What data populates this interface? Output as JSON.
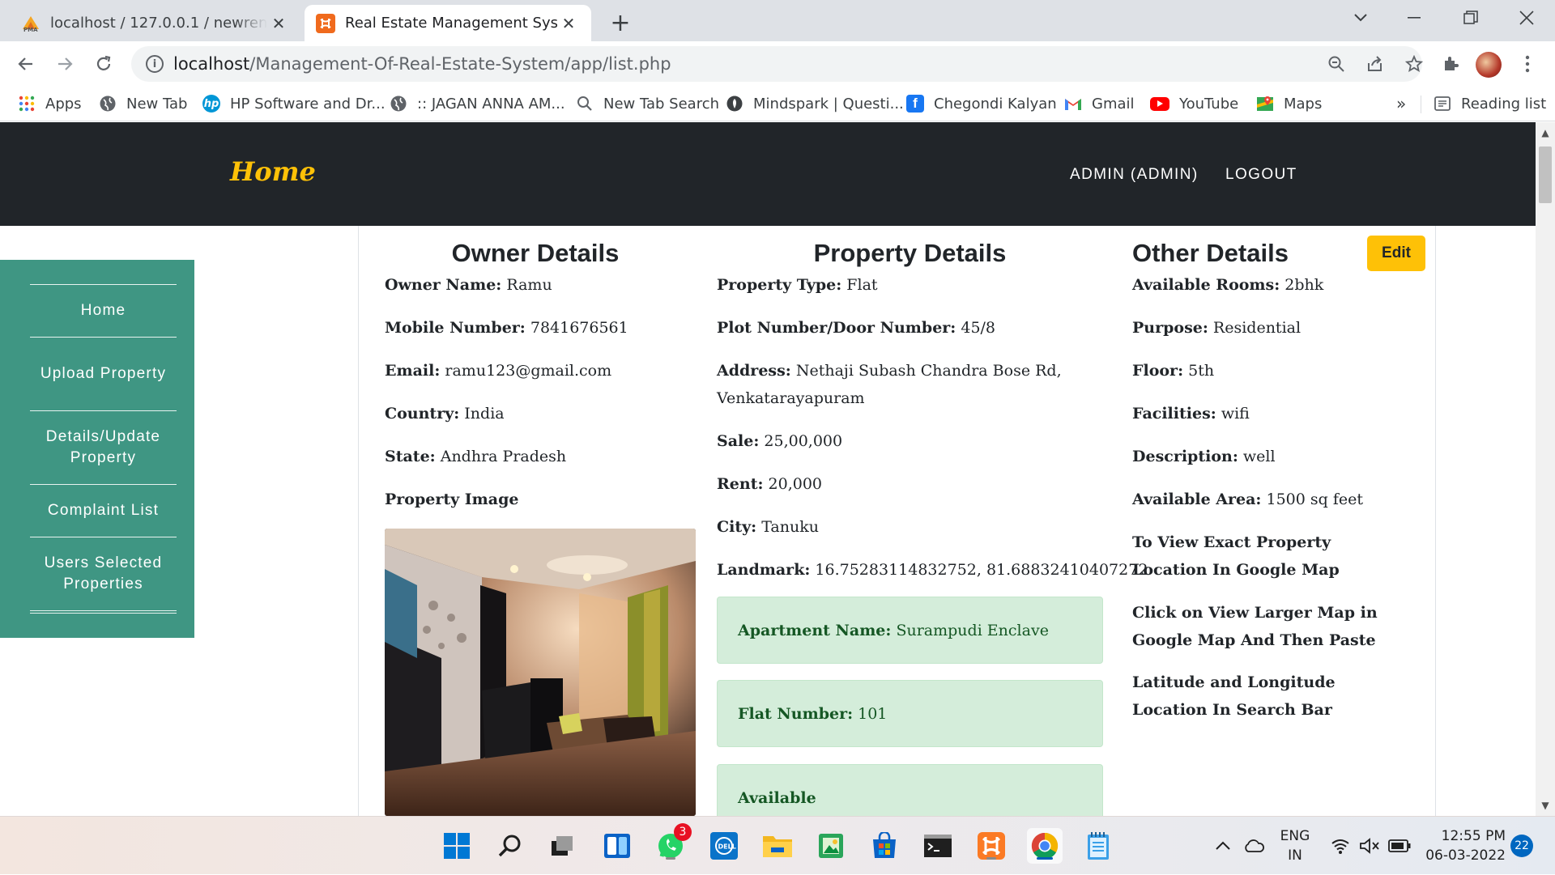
{
  "browser": {
    "tabs": [
      {
        "title": "localhost / 127.0.0.1 / newrent / u",
        "favicon": "phpmyadmin-icon",
        "close": "✕"
      },
      {
        "title": "Real Estate Management System",
        "favicon": "xampp-icon",
        "close": "✕"
      }
    ],
    "new_tab": "+",
    "address": {
      "host": "localhost",
      "path": "/Management-Of-Real-Estate-System/app/list.php"
    },
    "bookmarks": [
      {
        "label": "Apps",
        "icon": "apps-grid-icon"
      },
      {
        "label": "New Tab",
        "icon": "globe-icon"
      },
      {
        "label": "HP Software and Dr...",
        "icon": "hp-icon"
      },
      {
        "label": ":: JAGAN ANNA AM...",
        "icon": "globe-icon"
      },
      {
        "label": "New Tab Search",
        "icon": "search-icon"
      },
      {
        "label": "Mindspark | Questi...",
        "icon": "mindspark-icon"
      },
      {
        "label": "Chegondi Kalyan",
        "icon": "facebook-icon"
      },
      {
        "label": "Gmail",
        "icon": "gmail-icon"
      },
      {
        "label": "YouTube",
        "icon": "youtube-icon"
      },
      {
        "label": "Maps",
        "icon": "maps-icon"
      }
    ],
    "bookmarks_overflow": "»",
    "reading_list": "Reading list"
  },
  "site": {
    "brand": "Home",
    "nav": {
      "admin": "ADMIN (ADMIN)",
      "logout": "LOGOUT"
    },
    "sidebar": [
      {
        "label": "Home"
      },
      {
        "label": "Upload Property"
      },
      {
        "label": "Details/Update Property"
      },
      {
        "label": "Complaint List"
      },
      {
        "label": "Users Selected Properties"
      }
    ]
  },
  "details": {
    "owner": {
      "title": "Owner Details",
      "fields": [
        {
          "label": "Owner Name:",
          "value": " Ramu"
        },
        {
          "label": "Mobile Number:",
          "value": " 7841676561"
        },
        {
          "label": "Email:",
          "value": " ramu123@gmail.com"
        },
        {
          "label": "Country:",
          "value": " India"
        },
        {
          "label": "State:",
          "value": " Andhra Pradesh"
        },
        {
          "label": "Property Image",
          "value": ""
        }
      ]
    },
    "property": {
      "title": "Property Details",
      "fields": [
        {
          "label": "Property Type:",
          "value": " Flat"
        },
        {
          "label": "Plot Number/Door Number:",
          "value": " 45/8"
        },
        {
          "label": "Address:",
          "value": " Nethaji Subash Chandra Bose Rd,",
          "value2": "Venkatarayapuram"
        },
        {
          "label": "Sale:",
          "value": " 25,00,000"
        },
        {
          "label": "Rent:",
          "value": " 20,000"
        },
        {
          "label": "City:",
          "value": " Tanuku"
        },
        {
          "label": "Landmark:",
          "value": " 16.75283114832752, 81.68832410407272"
        }
      ],
      "alerts": [
        {
          "label": "Apartment Name:",
          "value": " Surampudi Enclave"
        },
        {
          "label": "Flat Number:",
          "value": " 101"
        },
        {
          "label": "Available",
          "value": ""
        }
      ]
    },
    "other": {
      "title": "Other Details",
      "edit": "Edit",
      "fields": [
        {
          "label": "Available Rooms:",
          "value": " 2bhk"
        },
        {
          "label": "Purpose:",
          "value": " Residential"
        },
        {
          "label": "Floor:",
          "value": " 5th"
        },
        {
          "label": "Facilities:",
          "value": " wifi"
        },
        {
          "label": "Description:",
          "value": " well"
        },
        {
          "label": "Available Area:",
          "value": " 1500 sq feet"
        }
      ],
      "notes": [
        {
          "line1": "To View Exact Property",
          "line2": "Location In Google Map"
        },
        {
          "line1": "Click on View Larger Map in",
          "line2": "Google Map And Then Paste"
        },
        {
          "line1": "Latitude and Longitude",
          "line2": "Location In Search Bar"
        }
      ]
    }
  },
  "taskbar": {
    "whatsapp_badge": "3",
    "lang": "ENG",
    "region": "IN",
    "time": "12:55 PM",
    "date": "06-03-2022",
    "notification_count": "22"
  },
  "colors": {
    "nav_bg": "#212529",
    "brand": "#fec107",
    "sidebar": "#3f9683",
    "edit_button": "#fec107",
    "alert_bg": "#d4edda",
    "alert_text": "#155724"
  }
}
